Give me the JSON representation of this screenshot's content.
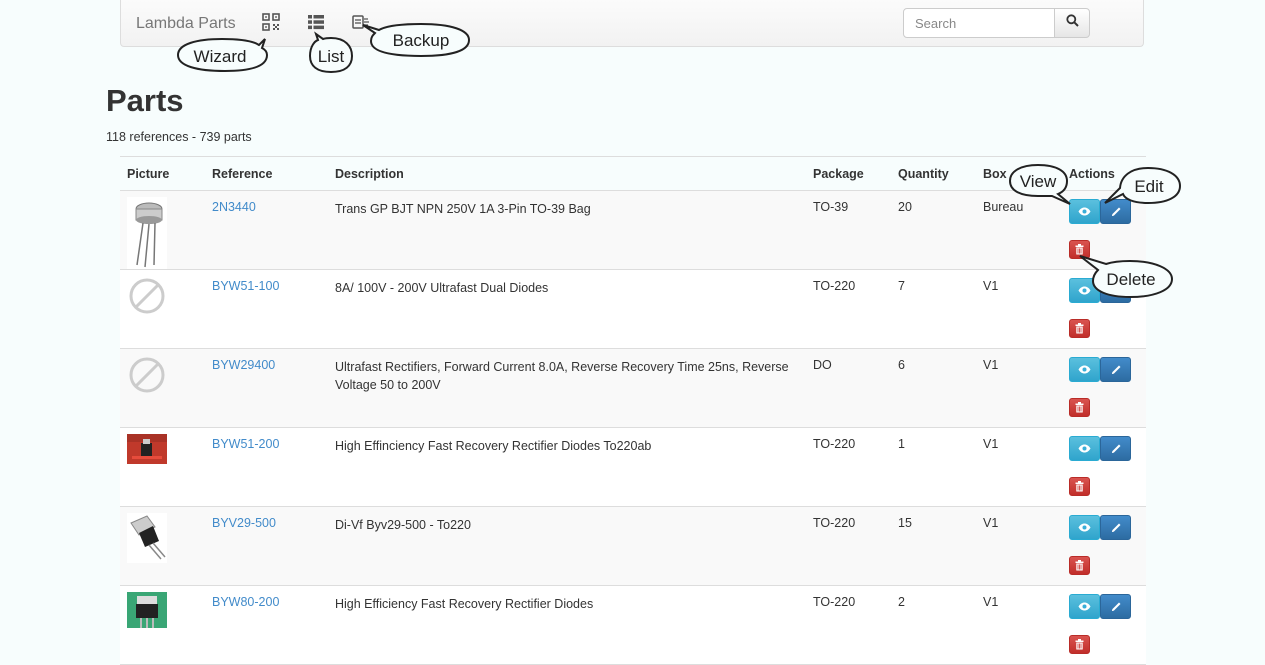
{
  "navbar": {
    "brand": "Lambda Parts",
    "icons": [
      "qr-code-icon",
      "list-icon",
      "backup-icon"
    ],
    "search_placeholder": "Search"
  },
  "page": {
    "title": "Parts",
    "subtitle": "118 references - 739 parts"
  },
  "table": {
    "headers": [
      "Picture",
      "Reference",
      "Description",
      "Package",
      "Quantity",
      "Box",
      "Actions"
    ],
    "rows": [
      {
        "reference": "2N3440",
        "description": "Trans GP BJT NPN 250V 1A 3-Pin TO-39 Bag",
        "package": "TO-39",
        "quantity": "20",
        "box": "Bureau",
        "picture": "to39-transistor"
      },
      {
        "reference": "BYW51-100",
        "description": "8A/ 100V - 200V Ultrafast Dual Diodes",
        "package": "TO-220",
        "quantity": "7",
        "box": "V1",
        "picture": "no-image"
      },
      {
        "reference": "BYW29400",
        "description": "Ultrafast Rectifiers, Forward Current 8.0A, Reverse Recovery Time 25ns, Reverse Voltage 50 to 200V",
        "package": "DO",
        "quantity": "6",
        "box": "V1",
        "picture": "no-image"
      },
      {
        "reference": "BYW51-200",
        "description": "High Effinciency Fast Recovery Rectifier Diodes To220ab",
        "package": "TO-220",
        "quantity": "1",
        "box": "V1",
        "picture": "red-board"
      },
      {
        "reference": "BYV29-500",
        "description": "Di-Vf Byv29-500 - To220",
        "package": "TO-220",
        "quantity": "15",
        "box": "V1",
        "picture": "to220-package"
      },
      {
        "reference": "BYW80-200",
        "description": "High Efficiency Fast Recovery Rectifier Diodes",
        "package": "TO-220",
        "quantity": "2",
        "box": "V1",
        "picture": "to220-green"
      }
    ]
  },
  "callouts": {
    "wizard": "Wizard",
    "list": "List",
    "backup": "Backup",
    "view": "View",
    "edit": "Edit",
    "delete": "Delete"
  },
  "colors": {
    "link": "#428bca",
    "view_button": "#5bc0de",
    "edit_button": "#428bca",
    "delete_button": "#d9534f"
  }
}
